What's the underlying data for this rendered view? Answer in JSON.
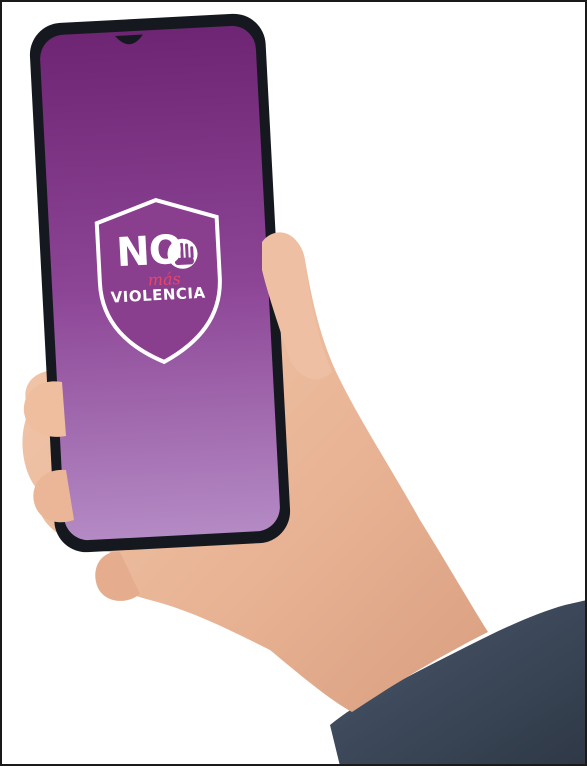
{
  "app_logo": {
    "line1": "NO",
    "line2": "más",
    "line3": "VIOLENCIA",
    "icon": "raised-hand-icon"
  },
  "colors": {
    "screen_top": "#6e2573",
    "screen_bottom": "#b07dbf",
    "shield_fill": "#8a3e8e",
    "shield_border": "#ffffff",
    "accent_script": "#e7466a",
    "phone_body": "#15191f",
    "skin": "#eab89a",
    "sleeve": "#3d4a5c"
  }
}
